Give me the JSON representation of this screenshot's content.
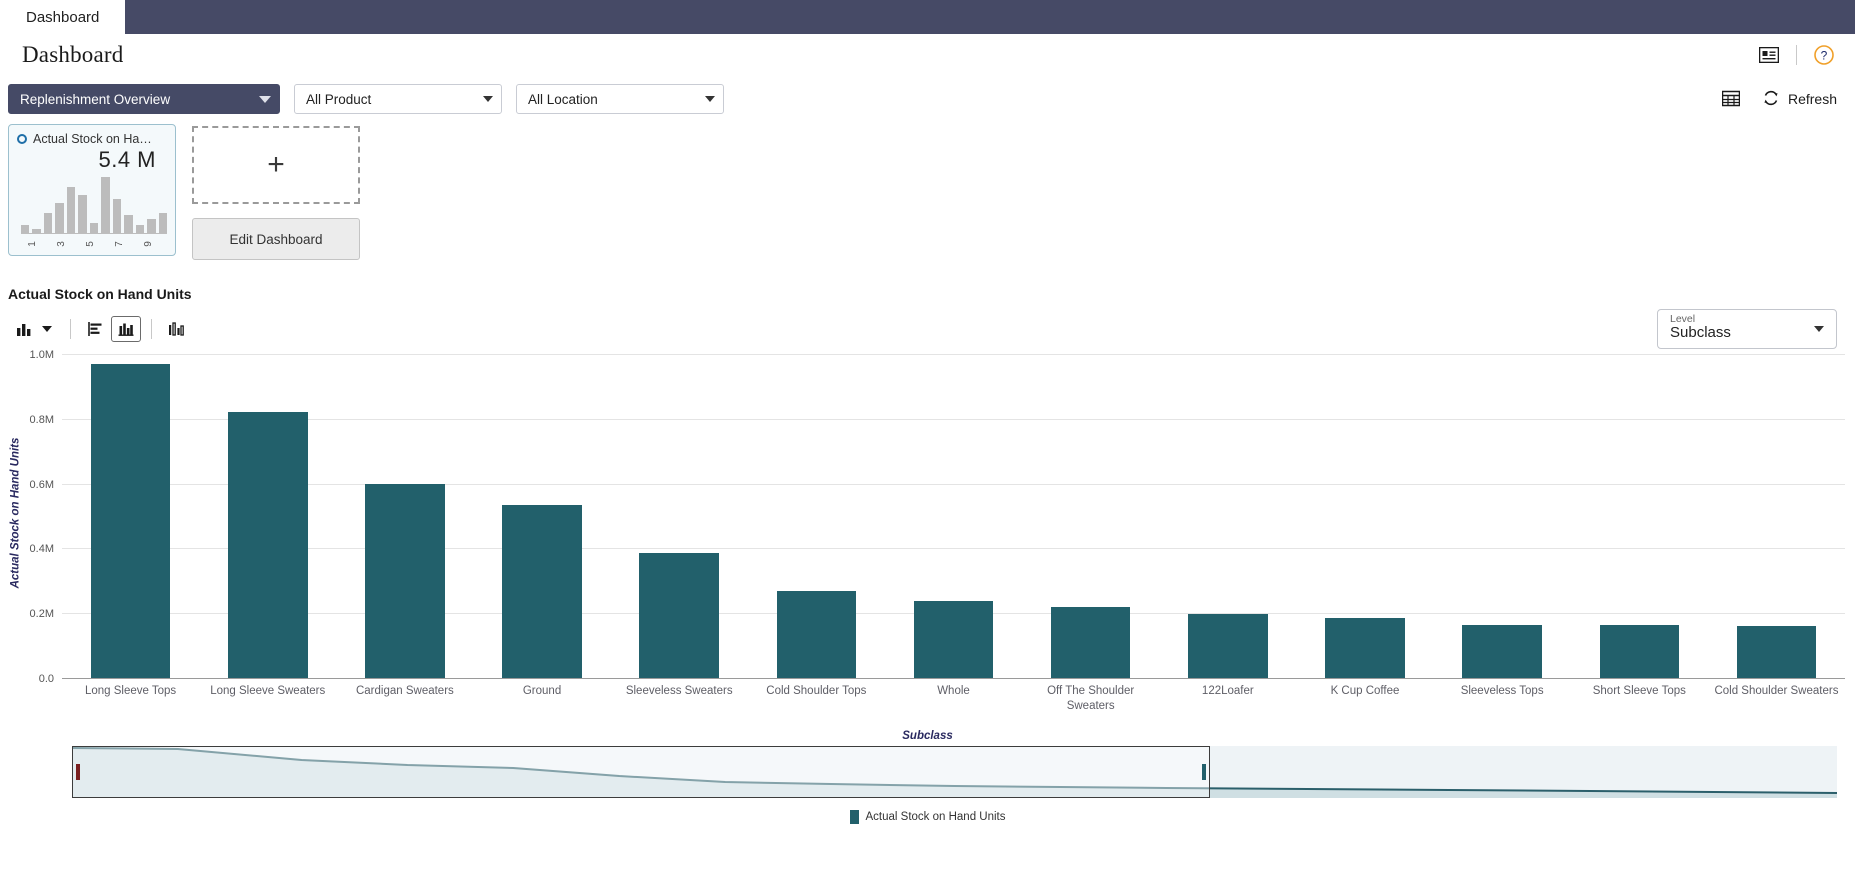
{
  "tabs": [
    {
      "label": "Dashboard"
    }
  ],
  "header": {
    "title": "Dashboard",
    "icons": [
      {
        "name": "contact-card-icon",
        "glyph": "▤"
      },
      {
        "name": "help-icon",
        "glyph": "?"
      }
    ]
  },
  "filters": {
    "dashboard_select": "Replenishment Overview",
    "product_select": "All Product",
    "location_select": "All Location",
    "table_view_icon": "grid-icon",
    "refresh_label": "Refresh"
  },
  "tiles": {
    "kpi": {
      "name": "Actual Stock on Ha…",
      "value": "5.4 M",
      "sparkline": [
        8,
        4,
        20,
        30,
        46,
        38,
        10,
        56,
        34,
        18,
        8,
        14,
        20
      ],
      "ticks": [
        "1",
        "3",
        "5",
        "7",
        "9"
      ]
    },
    "add_tile_glyph": "+",
    "edit_dashboard_label": "Edit Dashboard"
  },
  "chart_section": {
    "title": "Actual Stock on Hand Units",
    "toolbar": [
      {
        "name": "chart-type-icon",
        "glyph": "▮▮"
      },
      {
        "name": "horizontal-bar-icon",
        "glyph": "≣"
      },
      {
        "name": "vertical-bar-icon",
        "glyph": "▮▮▮"
      },
      {
        "name": "grouped-bar-icon",
        "glyph": "▯▮"
      }
    ],
    "level_dropdown": {
      "label": "Level",
      "value": "Subclass"
    }
  },
  "chart_data": {
    "type": "bar",
    "title": "Actual Stock on Hand Units",
    "xlabel": "Subclass",
    "ylabel": "Actual Stock on Hand Units",
    "ylim": [
      0,
      1000000
    ],
    "ytick_labels": [
      "1.0M",
      "0.8M",
      "0.6M",
      "0.4M",
      "0.2M",
      "0.0"
    ],
    "ytick_values": [
      1000000,
      800000,
      600000,
      400000,
      200000,
      0
    ],
    "grid": true,
    "legend": [
      "Actual Stock on Hand Units"
    ],
    "legend_position": "bottom",
    "color": "#22606b",
    "categories": [
      "Long Sleeve Tops",
      "Long Sleeve Sweaters",
      "Cardigan Sweaters",
      "Ground",
      "Sleeveless Sweaters",
      "Cold Shoulder Tops",
      "Whole",
      "Off The Shoulder Sweaters",
      "122Loafer",
      "K Cup Coffee",
      "Sleeveless Tops",
      "Short Sleeve Tops",
      "Cold Shoulder Sweaters"
    ],
    "values": [
      970000,
      820000,
      600000,
      535000,
      385000,
      268000,
      238000,
      218000,
      198000,
      186000,
      165000,
      163000,
      162000
    ]
  },
  "range_scrollbar": {
    "window_start_pct": 0,
    "window_end_pct": 64.5
  }
}
